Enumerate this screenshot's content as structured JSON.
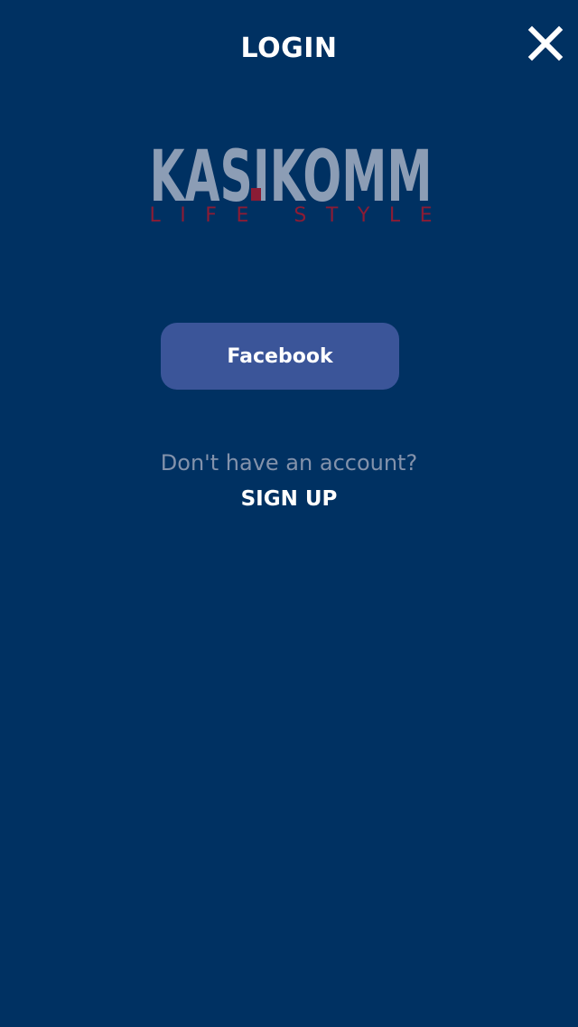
{
  "header": {
    "title": "LOGIN",
    "close_icon": "close-icon"
  },
  "logo": {
    "brand": "KASIKOMM",
    "tagline": "LIFE STYLE",
    "colors": {
      "brand": "#8c9db5",
      "accent": "#8b1c35"
    }
  },
  "login": {
    "facebook_label": "Facebook"
  },
  "signup": {
    "prompt": "Don't have an account?",
    "link_label": "SIGN UP"
  },
  "colors": {
    "background": "#003162",
    "facebook_button": "#3b5599",
    "prompt_text": "#8392ab",
    "text": "#ffffff"
  }
}
